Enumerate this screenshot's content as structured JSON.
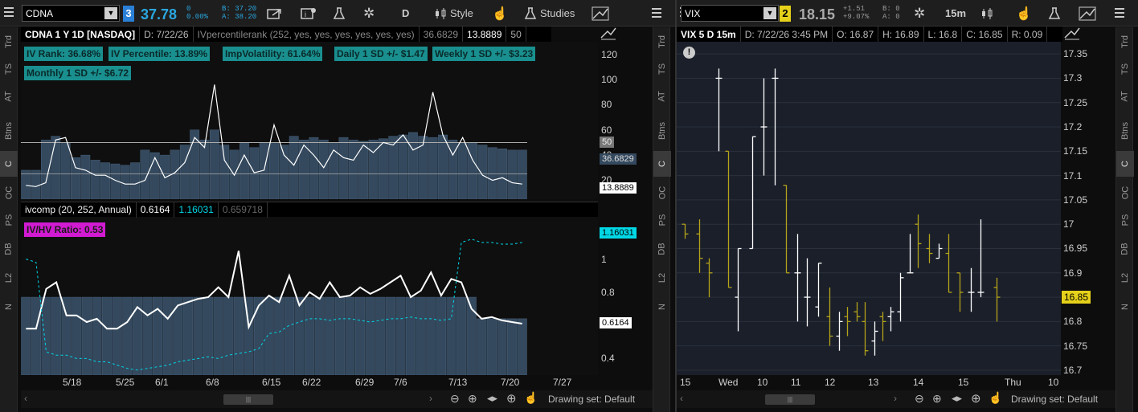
{
  "left": {
    "sidebar_tabs": [
      "Trd",
      "TS",
      "AT",
      "Btns",
      "C",
      "OC",
      "PS",
      "DB",
      "L2",
      "N"
    ],
    "symbol": "CDNA",
    "link_badge": "3",
    "last": "37.78",
    "change": "0",
    "change_pct": "0.00%",
    "bid": "B: 37.20",
    "ask": "A: 38.20",
    "period_btn": "D",
    "style_label": "Style",
    "studies_label": "Studies",
    "info": {
      "title": "CDNA 1 Y 1D [NASDAQ]",
      "date": "D: 7/22/26",
      "study": "IVpercentilerank (252, yes, yes, yes, yes, yes, yes)",
      "v1": "36.6829",
      "v2": "13.8889",
      "v3": "50"
    },
    "chips": [
      {
        "text": "IV Rank: 36.68%"
      },
      {
        "text": "IV Percentile: 13.89%"
      },
      {
        "text": "ImpVolatility: 61.64%"
      },
      {
        "text": "Daily 1 SD +/- $1.47"
      },
      {
        "text": "Weekly 1 SD +/- $3.23"
      },
      {
        "text": "Monthly 1 SD +/- $6.72"
      }
    ],
    "upper_axis": [
      "120",
      "100",
      "80",
      "60",
      "40",
      "20"
    ],
    "upper_tags": {
      "line50": "50",
      "rank": "36.6829",
      "pct": "13.8889"
    },
    "lower_info": {
      "study": "ivcomp (20, 252, Annual)",
      "v1": "0.6164",
      "v2": "1.16031",
      "v3": "0.659718"
    },
    "lower_chip": "IV/HV Ratio: 0.53",
    "lower_axis": [
      "1",
      "0.8",
      "0.6",
      "0.4"
    ],
    "lower_tags": {
      "cyan": "1.16031",
      "white": "0.6164"
    },
    "x_labels": [
      "5/18",
      "5/25",
      "6/1",
      "6/8",
      "6/15",
      "6/22",
      "6/29",
      "7/6",
      "7/13",
      "7/20",
      "7/27"
    ],
    "drawing_set": "Drawing set: Default"
  },
  "right": {
    "sidebar_tabs": [
      "Trd",
      "TS",
      "AT",
      "Btns",
      "C",
      "OC",
      "PS",
      "DB",
      "L2",
      "N"
    ],
    "symbol": "VIX",
    "link_badge": "2",
    "last": "18.15",
    "change": "+1.51",
    "change_pct": "+9.07%",
    "bid": "B: 0",
    "ask": "A: 0",
    "period_btn": "15m",
    "info": {
      "title": "VIX 5 D 15m",
      "date": "D: 7/22/26 3:45 PM",
      "o": "O: 16.87",
      "h": "H: 16.89",
      "l": "L: 16.8",
      "c": "C: 16.85",
      "r": "R: 0.09"
    },
    "price_axis": [
      "17.35",
      "17.3",
      "17.25",
      "17.2",
      "17.15",
      "17.1",
      "17.05",
      "17",
      "16.95",
      "16.9",
      "16.85",
      "16.8",
      "16.75",
      "16.7"
    ],
    "last_tag": "16.85",
    "x_labels": [
      "15",
      "Wed",
      "10",
      "11",
      "12",
      "13",
      "14",
      "15",
      "Thu",
      "10"
    ],
    "drawing_set": "Drawing set: Default"
  },
  "colors": {
    "teal_chip": "#1a8f8f",
    "magenta_chip": "#d11ad1",
    "bar_fill": "#34495e",
    "cyan": "#00d8e6",
    "olive": "#b5a31a",
    "accent_blue": "#2aa7e0",
    "vix_yellow": "#e6d11a"
  },
  "chart_data": [
    {
      "type": "bar",
      "title": "CDNA 1 Y 1D [NASDAQ]",
      "xlabel": "",
      "ylabel": "",
      "x_tick_labels": [
        "5/18",
        "5/25",
        "6/1",
        "6/8",
        "6/15",
        "6/22",
        "6/29",
        "7/6",
        "7/13",
        "7/20",
        "7/27"
      ],
      "ylim": [
        10,
        130
      ],
      "series": [
        {
          "name": "IV Percentile histogram",
          "values": [
            28,
            28,
            52,
            55,
            50,
            38,
            40,
            36,
            34,
            33,
            32,
            34,
            44,
            42,
            40,
            44,
            48,
            60,
            52,
            60,
            48,
            44,
            50,
            46,
            50,
            50,
            48,
            55,
            52,
            54,
            52,
            50,
            54,
            52,
            51,
            52,
            53,
            55,
            56,
            58,
            55,
            54,
            56,
            52,
            50,
            50,
            48,
            46,
            45,
            44,
            44
          ]
        },
        {
          "name": "IV Rank line",
          "values": [
            16,
            15,
            18,
            52,
            54,
            30,
            28,
            24,
            24,
            20,
            17,
            17,
            20,
            38,
            22,
            26,
            34,
            54,
            46,
            96,
            36,
            24,
            40,
            26,
            28,
            64,
            40,
            32,
            48,
            40,
            30,
            44,
            38,
            36,
            48,
            42,
            50,
            48,
            56,
            44,
            48,
            90,
            56,
            40,
            54,
            36,
            24,
            20,
            22,
            18,
            17
          ]
        },
        {
          "name": "50 line",
          "values": [
            50
          ]
        },
        {
          "name": "Lower line",
          "values": [
            25
          ]
        }
      ]
    },
    {
      "type": "bar",
      "title": "ivcomp (20, 252, Annual)",
      "x_tick_labels": [
        "5/18",
        "5/25",
        "6/1",
        "6/8",
        "6/15",
        "6/22",
        "6/29",
        "7/6",
        "7/13",
        "7/20",
        "7/27"
      ],
      "ylim": [
        0.3,
        1.2
      ],
      "series": [
        {
          "name": "HV bars",
          "values": [
            0.77,
            0.77,
            0.77,
            0.77,
            0.77,
            0.77,
            0.77,
            0.77,
            0.77,
            0.77,
            0.77,
            0.77,
            0.77,
            0.77,
            0.77,
            0.77,
            0.77,
            0.77,
            0.77,
            0.77,
            0.77,
            0.77,
            0.77,
            0.77,
            0.77,
            0.77,
            0.77,
            0.77,
            0.77,
            0.77,
            0.77,
            0.77,
            0.77,
            0.77,
            0.77,
            0.77,
            0.77,
            0.77,
            0.77,
            0.77,
            0.77,
            0.77,
            0.77,
            0.77,
            0.77,
            0.64,
            0.64,
            0.64,
            0.64,
            0.64
          ]
        },
        {
          "name": "IV line",
          "values": [
            0.58,
            0.58,
            0.82,
            0.86,
            0.66,
            0.66,
            0.62,
            0.64,
            0.58,
            0.58,
            0.62,
            0.71,
            0.66,
            0.7,
            0.64,
            0.72,
            0.74,
            0.76,
            0.77,
            0.83,
            0.77,
            1.05,
            0.59,
            0.72,
            0.78,
            0.74,
            0.9,
            0.72,
            0.8,
            0.76,
            0.86,
            0.77,
            0.78,
            0.83,
            0.79,
            0.82,
            0.86,
            0.9,
            0.77,
            0.81,
            0.92,
            0.78,
            0.88,
            0.86,
            0.7,
            0.64,
            0.65,
            0.63,
            0.62,
            0.61
          ]
        },
        {
          "name": "IV/HV dashed",
          "values": [
            1.0,
            0.98,
            0.44,
            0.42,
            0.42,
            0.4,
            0.4,
            0.38,
            0.38,
            0.36,
            0.34,
            0.33,
            0.34,
            0.35,
            0.36,
            0.38,
            0.39,
            0.4,
            0.41,
            0.4,
            0.42,
            0.43,
            0.44,
            0.46,
            0.55,
            0.56,
            0.6,
            0.62,
            0.64,
            0.64,
            0.63,
            0.64,
            0.64,
            0.63,
            0.62,
            0.63,
            0.64,
            0.64,
            0.65,
            0.64,
            0.64,
            0.63,
            0.64,
            1.1,
            1.12,
            1.1,
            1.1,
            1.09,
            1.09,
            1.1
          ]
        }
      ]
    },
    {
      "type": "bar",
      "title": "VIX 5 D 15m",
      "x_tick_labels": [
        "15",
        "Wed",
        "10",
        "11",
        "12",
        "13",
        "14",
        "15",
        "Thu",
        "10"
      ],
      "ylim": [
        16.7,
        17.37
      ],
      "series": [
        {
          "name": "OHLC",
          "values": [
            [
              17.0,
              17.0,
              16.97,
              16.98
            ],
            [
              16.98,
              17.01,
              16.9,
              16.93
            ],
            [
              16.92,
              16.93,
              16.85,
              16.9
            ],
            [
              17.3,
              17.32,
              17.15,
              17.3
            ],
            [
              17.15,
              17.15,
              16.87,
              16.87
            ],
            [
              16.85,
              16.95,
              16.78,
              16.95
            ],
            [
              16.95,
              17.18,
              16.95,
              17.18
            ],
            [
              17.2,
              17.3,
              17.1,
              17.2
            ],
            [
              17.3,
              17.32,
              17.08,
              17.3
            ],
            [
              17.08,
              17.08,
              16.9,
              16.9
            ],
            [
              16.9,
              16.98,
              16.8,
              16.9
            ],
            [
              16.85,
              16.93,
              16.79,
              16.85
            ],
            [
              16.83,
              16.92,
              16.81,
              16.92
            ],
            [
              16.81,
              16.87,
              16.75,
              16.77
            ],
            [
              16.77,
              16.82,
              16.74,
              16.8
            ],
            [
              16.81,
              16.83,
              16.77,
              16.8
            ],
            [
              16.82,
              16.84,
              16.8,
              16.81
            ],
            [
              16.8,
              16.84,
              16.73,
              16.74
            ],
            [
              16.76,
              16.8,
              16.73,
              16.78
            ],
            [
              16.81,
              16.82,
              16.76,
              16.8
            ],
            [
              16.81,
              16.83,
              16.78,
              16.82
            ],
            [
              16.82,
              16.9,
              16.8,
              16.89
            ],
            [
              16.9,
              16.98,
              16.9,
              16.9
            ],
            [
              17.0,
              17.02,
              16.91,
              16.96
            ],
            [
              16.95,
              16.98,
              16.92,
              16.94
            ],
            [
              16.93,
              16.96,
              16.93,
              16.95
            ],
            [
              16.94,
              16.98,
              16.86,
              16.86
            ],
            [
              16.9,
              16.9,
              16.82,
              16.86
            ],
            [
              16.86,
              16.91,
              16.82,
              16.86
            ],
            [
              16.86,
              17.01,
              16.85,
              16.86
            ],
            [
              16.87,
              16.89,
              16.8,
              16.85
            ]
          ]
        }
      ]
    }
  ]
}
